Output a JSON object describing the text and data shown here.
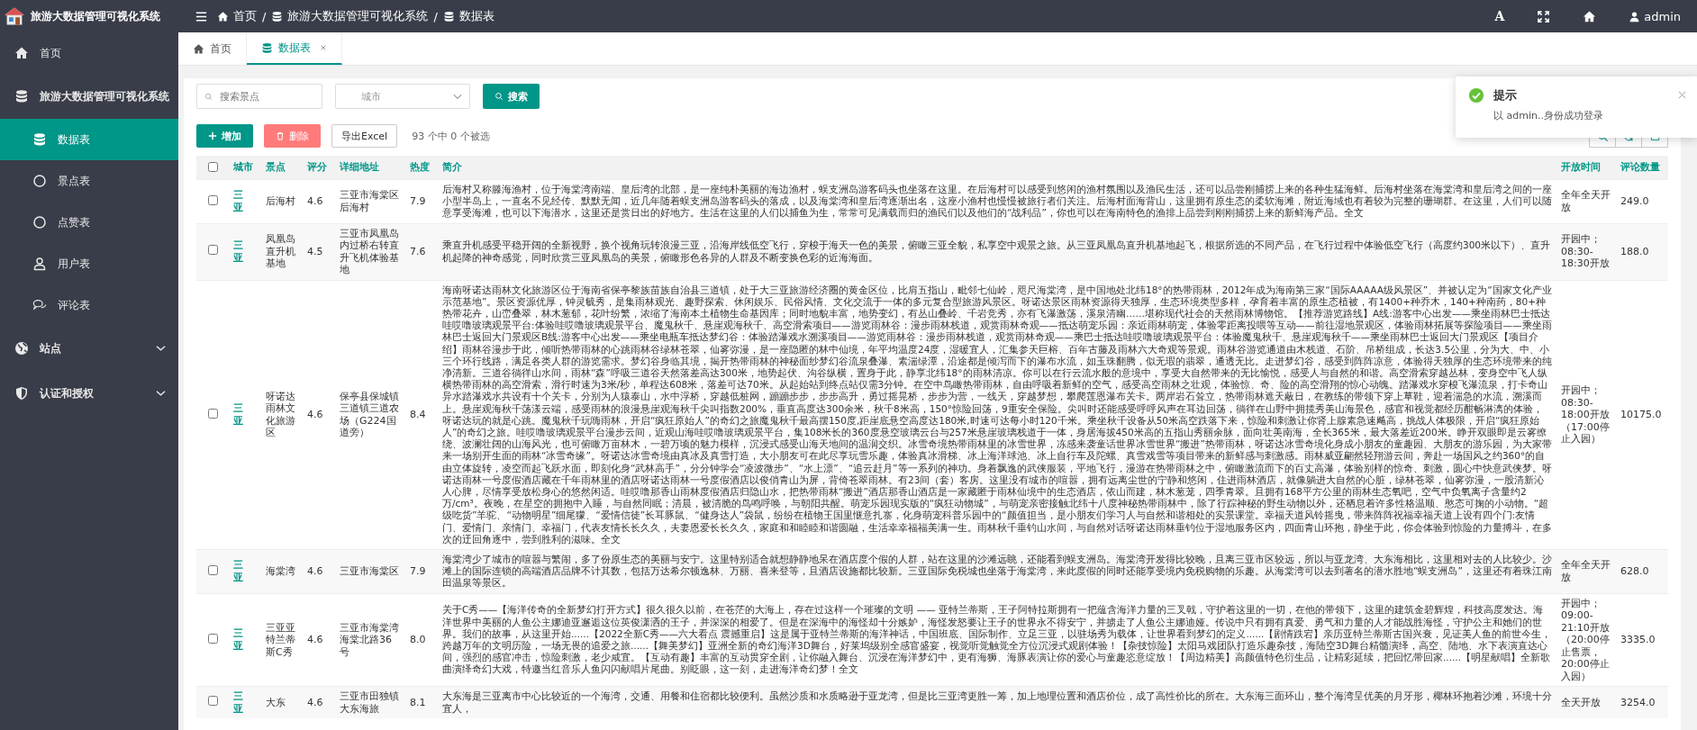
{
  "app": {
    "title": "旅游大数据管理可视化系统"
  },
  "header": {
    "breadcrumb": [
      {
        "label": "首页"
      },
      {
        "label": "旅游大数据管理可视化系统"
      },
      {
        "label": "数据表"
      }
    ],
    "separators": [
      "/",
      "/"
    ],
    "font_button": "A",
    "user": "admin"
  },
  "sidebar": {
    "items": [
      {
        "label": "首页",
        "selected": false
      },
      {
        "label": "旅游大数据管理可视化系统",
        "expanded": true,
        "children": [
          {
            "label": "数据表",
            "selected": true
          },
          {
            "label": "景点表",
            "selected": false
          },
          {
            "label": "点赞表",
            "selected": false
          },
          {
            "label": "用户表",
            "selected": false
          },
          {
            "label": "评论表",
            "selected": false
          }
        ]
      },
      {
        "label": "站点",
        "expanded": false
      },
      {
        "label": "认证和授权",
        "expanded": false
      }
    ]
  },
  "tabs": [
    {
      "label": "首页",
      "selected": false,
      "closable": false
    },
    {
      "label": "数据表",
      "selected": true,
      "closable": true
    }
  ],
  "search": {
    "placeholder": "搜索景点",
    "city_placeholder": "城市",
    "button": "搜索"
  },
  "actions": {
    "add": "增加",
    "delete": "删除",
    "export": "导出Excel",
    "selection_info": "93 个中 0 个被选"
  },
  "table": {
    "all_checked": false,
    "columns": [
      "城市",
      "景点",
      "评分",
      "详细地址",
      "热度",
      "简介",
      "开放时间",
      "评论数量"
    ],
    "rows": [
      {
        "checked": false,
        "city": "三亚",
        "name": "后海村",
        "score": "4.6",
        "address": "三亚市海棠区后海村",
        "hotness": "7.9",
        "description": "后海村又称滕海渔村，位于海棠湾南端、皇后湾的北部，是一座纯朴美丽的海边渔村，蜈支洲岛游客码头也坐落在这里。在后海村可以感受到悠闲的渔村氛围以及渔民生活，还可以品尝刚捕捞上来的各种生猛海鲜。后海村坐落在海棠湾和皇后湾之间的一座小型半岛上，一直名不见经传、默默无闻，近几年随着蜈支洲岛游客码头的落成，以及海棠湾和皇后湾逐渐出名，这座小渔村也慢慢被旅行者们关注。后海村面海背山，这里拥有原生态的柔软海滩，附近海域也有着较为完整的珊瑚群。在这里，人们可以随意享受海滩，也可以下海潜水，这里还是赏日出的好地方。生活在这里的人们以捕鱼为生，常常可见满载而归的渔民们以及他们的“战利品”，你也可以在海南特色的渔排上品尝到刚刚捕捞上来的新鲜海产品。全文",
        "open_time": "全年全天开放",
        "comment_count": "249.0"
      },
      {
        "checked": false,
        "city": "三亚",
        "name": "凤凰岛直升机基地",
        "score": "4.5",
        "address": "三亚市凤凰岛内过桥右转直升飞机体验基地",
        "hotness": "7.6",
        "description": "乘直升机感受平稳开阔的全新视野，换个视角玩转浪漫三亚，沿海岸线低空飞行，穿梭于海天一色的美景，俯瞰三亚全貌，私享空中观景之旅。从三亚凤凰岛直升机基地起飞，根据所选的不同产品，在飞行过程中体验低空飞行（高度约300米以下）、直升机起降的神奇感觉，同时欣赏三亚凤凰岛的美景，俯瞰形色各异的人群及不断变换色彩的近海海面。",
        "open_time": "开园中；08:30-18:30开放",
        "comment_count": "188.0"
      },
      {
        "checked": false,
        "city": "三亚",
        "name": "呀诺达雨林文化旅游区",
        "score": "4.6",
        "address": "保亭县保城镇三道镇三道农场（G224国道旁）",
        "hotness": "8.4",
        "description": "海南呀诺达雨林文化旅游区位于海南省保亭黎族苗族自治县三道镇，处于大三亚旅游经济圈的黄金区位，比肩五指山，毗邻七仙岭，咫尺海棠湾，是中国地处北纬18°的热带雨林，2012年成为海南第三家“国际AAAAA级风景区”、并被认定为“国家文化产业示范基地”。景区资源优厚，钟灵毓秀，是集雨林观光、趣野探索、休闲娱乐、民俗风情、文化交流于一体的多元复合型旅游风景区。呀诺达景区雨林资源得天独厚，生态环境类型多样，孕育着丰富的原生态植被，有1400+种乔木，140+种南药，80+种热带花卉，山峦叠翠，林木葱郁，花叶纷繁，浓缩了海南本土植物生命基因库；同时地貌丰富，地势变幻，有丛山叠岭、千岩竞秀，亦有飞瀑激荡，溪泉清幽……堪称现代社会的天然雨林博物馆。【推荐游览路线】A线:游客中心出发——乘坐雨林巴士抵达哇哎噜玻璃观景平台:体验哇哎噜玻璃观景平台、魔鬼秋千、悬崖观海秋千、高空滑索项目——游览雨林谷：漫步雨林栈道，观赏雨林奇观——抵达萌宠乐园：亲近雨林萌宠，体验零距离投喂等互动——前往湿地景观区，体验雨林拓展等探险项目——乘坐雨林巴士返回大门景观区B线:游客中心出发——乘坐电瓶车抵达梦幻谷：体验踏瀑戏水溯溪项目——游览雨林谷：漫步雨林栈道，观赏雨林奇观——乘巴士抵达哇哎噜玻璃观景平台：体验魔鬼秋千、悬崖观海秋千——乘坐雨林巴士返回大门景观区【项目介绍】雨林谷漫步于此，倾听热带雨林的心跳雨林谷绿林苍翠，仙雾弥漫，是一座隐匿的林中仙境，年平均温度24度，湿暖宜人，汇集参天巨榕、百年古藤及雨林六大奇观等景观。雨林谷游览通道由木栈道、石阶、吊桥组成，长达3.5公里，分为大、中、小三个环行线路，满足各类人群的游览需求。梦幻谷身临其境，揭开热带雨林的神秘面纱梦幻谷流泉叠瀑、素湍绿潭，沿途都是倾泻而下的瀑布水流，如玉珠翻腾，似无瑕的翡翠，通透无比。走进梦幻谷，感受到阵阵凉意，体验得天独厚的生态环境带来的纯净清新。三道谷徜徉山水间，雨林“森”呼吸三道谷天然落差高达300米，地势起伏、沟谷纵横，置身于此，静享北纬18°的雨林清凉。你可以在行云流水般的意境中，享受大自然带来的无比愉悦，感受人与自然的和谐。高空滑索穿越丛林，变身空中飞人纵横热带雨林的高空滑索，滑行时速为3米/秒，单程达608米，落差可达70米。从起始站到终点站仅需3分钟。在空中鸟瞰热带雨林，自由呼吸着新鲜的空气，感受高空雨林之壮观，体验惊、奇、险的高空滑翔的惊心动魄。踏瀑戏水穿梭飞瀑流泉，打卡奇山异水踏瀑戏水共设有十个关卡，分别为人猿泰山，水中浮桥，穿越低桩网，蹦蹦步步，步步高升，勇过摇晃桥，步步为营，一线天，穿越梦想，攀爬莲恩瀑布关卡。两岸岩石耸立，热带雨林遮天蔽日，在教练的带领下穿上草鞋，迎着湍急的水流，溯溪而上。悬崖观海秋千荡漾云端，感受雨林的浪漫悬崖观海秋千尖叫指数200%，垂直高度达300余米，秋千8米高，150°惊险回荡，9重安全保险。尖叫时还能感受呼呼风声在耳边回荡，徜徉在山野中拥揽秀美山海景色，感官和视觉都经历酣畅淋漓的体验，呀诺达玩的就是心跳。魔鬼秋千玩嗨雨林，开启“疯狂原始人”的奇幻之旅魔鬼秋千最高摆150度,距崖底悬空高度达180米,时速可达每小时120千米。乘坐秋千设备从50米高空跌落下来，惊险和刺激让你肾上腺素急速飚高，挑战人体极限，开启“疯狂原始人”的奇幻之旅。哇哎噜玻璃观景平台漫步云间，近观山海哇哎噜玻璃观景平台，集108米长的360度悬空玻璃云台与257米悬崖玻璃栈道于一体，身居海拔450米高的五指山秀丽余脉，面向壮美南海，全长365米，最大落差近200米。睁开双眼即是云雾缭绕、波澜壮阔的山海风光，也可俯瞰万亩林木，一碧万顷的魅力模样，沉浸式感受山海天地间的温润交织。冰雪奇境热带雨林里的冰雪世界，冻感来袭童话世界冰雪世界“搬进”热带雨林，呀诺达冰雪奇境化身成小朋友的童趣园、大朋友的游乐园，为大家带来一场别开生面的雨林“冰雪奇缘”。呀诺达冰雪奇境由真冰及真雪打造，大小朋友可在此尽享玩雪乐趣，体验真冰滑梯、冰上海洋球池、冰上自行车及陀螺、真雪戏雪等项目带来的新鲜感与刺激感。雨林威亚翩然轻翔游云间，奔赴一场国风之约360°的自由立体旋转，凌空而起飞跃水面，即刻化身“武林高手”，分分钟学会“凌波微步”、“水上漂”、“追云赶月”等一系列的神功。身着飘逸的武侠服装，平地飞行，漫游在热带雨林之中，俯瞰激流而下的百丈高瀑，体验别样的惊奇、刺激，圆心中快意武侠梦。呀诺达雨林一号度假酒店藏在千年雨林里的酒店呀诺达雨林一号度假酒店以俊俏青山为屏，背倚苍翠雨林。有23间（套）客房。这里没有城市的喧嚣，拥有远离尘世的宁静和悠闲，住进雨林酒店，就像躺进大自然的心脏，绿林苍翠，仙雾弥漫，一股清新沁人心脾，尽情享受放松身心的悠然闲适。哇哎噜那香山雨林度假酒店归隐山水，把热带雨林“搬进”酒店那香山酒店是一家藏匿于雨林仙境中的生态酒店，依山而建，林木葱茏，四季青翠。且拥有168平方公里的雨林生态氧吧，空气中负氧离子含量约2万/cm³。夜晚，在星空的拥抱中入睡，与自然同眠；清晨，被清脆的鸟鸣呼唤，与朝阳共醒。萌宠乐园现实版的“疯狂动物城”，与萌宠亲密接触北纬十八度神秘热带雨林中，除了行踪神秘的野生动物以外，还栖息着许多性格温顺、憨态可掬的小动物。“超级吃货”羊驼、“动物明星”细尾獴、“爱情信徒”长耳豚鼠、“健身达人”袋鼠，纷纷在植物王国里惬意扎寨，化身萌宠科普乐园中的“颜值担当，是小朋友们学习人与自然和谐相处的实景课堂。幸福天道风铃摇曳，带来阵阵祝福幸福天道上设有四个门:友情门、爱情门、亲情门、幸福门，代表友情长长久久，夫妻恩爱长长久久，家庭和和睦睦和谐圆融，生活幸幸福福美满一生。雨林秋千垂钓山水间，与自然对话呀诺达雨林垂钓位于湿地服务区内，四面青山环抱，静坐于此，你会体验到惊险的力量搏斗，在多次的迂回角逐中，尝到胜利的滋味。全文",
        "open_time": "开园中；08:30-18:00开放（17:00停止入园）",
        "comment_count": "10175.0"
      },
      {
        "checked": false,
        "city": "三亚",
        "name": "海棠湾",
        "score": "4.6",
        "address": "三亚市海棠区",
        "hotness": "7.9",
        "description": "海棠湾少了城市的喧嚣与繁闹，多了份原生态的美丽与安宁。这里特别适合就想静静地呆在酒店度个假的人群，站在这里的沙滩远眺，还能看到蜈支洲岛。海棠湾开发得比较晚，且离三亚市区较远，所以与亚龙湾、大东海相比，这里相对去的人比较少。沙滩上的国际连锁的高端酒店品牌不计其数，包括万达希尔顿逸林、万丽、喜来登等，且酒店设施都比较新。三亚国际免税城也坐落于海棠湾，来此度假的同时还能享受境内免税购物的乐趣。从海棠湾可以去到著名的潜水胜地“蜈支洲岛”，这里还有着珠江南田温泉等景区。",
        "open_time": "全年全天开放",
        "comment_count": "628.0"
      },
      {
        "checked": false,
        "city": "三亚",
        "name": "三亚亚特兰蒂斯C秀",
        "score": "4.6",
        "address": "三亚市海棠湾海棠北路36号",
        "hotness": "8.0",
        "description": "关于C秀——【海洋传奇的全新梦幻打开方式】很久很久以前，在苍茫的大海上，存在过这样一个璀璨的文明 —— 亚特兰蒂斯，王子阿特拉斯拥有一把蕴含海洋力量的三叉戟，守护着这里的一切，在他的带领下，这里的建筑金碧辉煌，科技高度发达。海洋世界中美丽的人鱼公主娜迪亚邂逅这位英俊潇洒的王子，并深深的相爱了。但是在深海中的海怪却十分嫉妒，海怪发怒要让王子的世界永不得安宁，并掳走了人鱼公主娜迪娅。传说中只有拥有真爱、勇气和力量的人才能战胜海怪，守护公主和她们的世界。我们的故事，从这里开始......【2022全新C秀——六大看点 震撼重启】这是属于亚特兰蒂斯的海洋神话，中国班底、国际制作、立足三亚，以驻场秀为载体，让世界看到梦幻的定义......【剧情跌宕】亲历亚特兰蒂斯古国兴衰，见证美人鱼的前世今生，跨越万年的文明历险，一场无畏的追爱之旅......【舞美梦幻】亚洲全新的奇幻海洋3D舞台，好莱坞级别全感官盛宴，视觉听觉触觉全方位沉浸式观剧体验！【杂技惊险】太阳马戏团队打造乐趣杂技，海陆空3D舞台精髓演绎，高空、陆地、水下表演直达心间，强烈的感官冲击，惊险刺激，老少咸宜。【互动有趣】丰富的互动贯穿全剧，让你融入舞台、沉浸在海洋梦幻中，更有海狮、海豚表演让你的爱心与童趣恣意绽放！【周边精美】高颜值特色衍生品，让精彩延续，把回忆带回家......【明星献唱】全新歌曲演绎奇幻大戏，特邀当红音乐人鱼闪闪献唱片尾曲。别眨眼，这一刻，走进海洋奇幻梦！全文",
        "open_time": "开园中；09:00-21:10开放（20:00停止售票，20:00停止入园）",
        "comment_count": "3335.0"
      },
      {
        "checked": false,
        "city": "三亚",
        "name": "大东",
        "score": "4.6",
        "address": "三亚市田独镇大东海旅",
        "hotness": "8.1",
        "description": "大东海是三亚离市中心比较近的一个海湾，交通、用餐和住宿都比较便利。虽然沙质和水质略逊于亚龙湾，但是比三亚湾更胜一筹，加上地理位置和酒店价位，成了高性价比的所在。大东海三面环山，整个海湾呈优美的月牙形，椰林环抱着沙滩，环境十分宜人，",
        "open_time": "全天开放",
        "comment_count": "3254.0"
      }
    ]
  },
  "toast": {
    "title": "提示",
    "message": "以 admin..身份成功登录"
  }
}
